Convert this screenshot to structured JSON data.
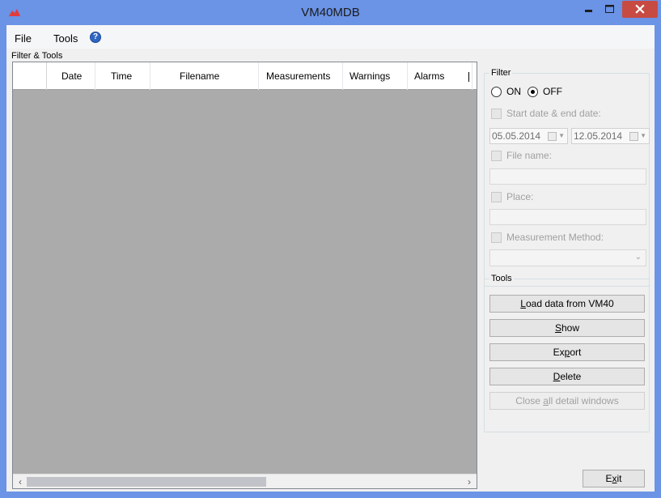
{
  "window": {
    "title": "VM40MDB"
  },
  "menu": {
    "file": "File",
    "tools": "Tools"
  },
  "section_label": "Filter & Tools",
  "grid": {
    "columns": [
      "Date",
      "Time",
      "Filename",
      "Measurements",
      "Warnings",
      "Alarms"
    ]
  },
  "filter": {
    "title": "Filter",
    "radio_on": "ON",
    "radio_off": "OFF",
    "selected": "OFF",
    "date_checkbox": "Start date & end date:",
    "start_date": "05.05.2014",
    "end_date": "12.05.2014",
    "filename_checkbox": "File name:",
    "filename_value": "",
    "place_checkbox": "Place:",
    "place_value": "",
    "method_checkbox": "Measurement Method:",
    "method_value": ""
  },
  "tools": {
    "title": "Tools",
    "load_prefix": "L",
    "load_rest": "oad data from VM40",
    "show_prefix": "S",
    "show_rest": "how",
    "export_prefix": "Ex",
    "export_mid": "p",
    "export_rest": "ort",
    "delete_prefix": "D",
    "delete_rest": "elete",
    "close_prefix": "Close ",
    "close_mid": "a",
    "close_rest": "ll detail windows"
  },
  "exit": {
    "prefix": "E",
    "mid": "x",
    "rest": "it"
  },
  "colors": {
    "titlebar": "#6b93e6",
    "close_button": "#c74b43",
    "grid_background": "#ababab"
  }
}
